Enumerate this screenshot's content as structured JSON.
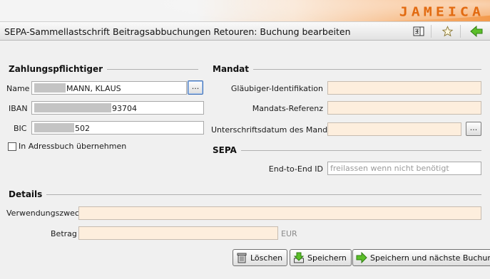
{
  "header": {
    "logo": "JAMEICA",
    "title": "SEPA-Sammellastschrift Beitragsabbuchungen Retouren: Buchung bearbeiten",
    "toolbar_icons": [
      "panel-toggle-icon",
      "star-icon",
      "back-arrow-icon"
    ]
  },
  "payer": {
    "heading": "Zahlungspflichtiger",
    "name_label": "Name",
    "name_value": "MANN, KLAUS",
    "iban_label": "IBAN",
    "iban_value": "93704",
    "bic_label": "BIC",
    "bic_value": "502",
    "browse_label": "...",
    "addressbook_label": "In Adressbuch übernehmen"
  },
  "mandate": {
    "heading": "Mandat",
    "creditor_label": "Gläubiger-Identifikation",
    "creditor_value": "",
    "reference_label": "Mandats-Referenz",
    "reference_value": "",
    "signature_date_label": "Unterschriftsdatum des Mandats",
    "signature_date_value": "",
    "date_picker_label": "..."
  },
  "sepa": {
    "heading": "SEPA",
    "e2e_label": "End-to-End ID",
    "e2e_placeholder": "freilassen wenn nicht benötigt"
  },
  "details": {
    "heading": "Details",
    "purpose_label": "Verwendungszweck",
    "purpose_value": "",
    "amount_label": "Betrag",
    "amount_value": "",
    "currency": "EUR"
  },
  "actions": {
    "delete_label": "Löschen",
    "save_label": "Speichern",
    "save_next_label": "Speichern und nächste Buchung"
  },
  "colors": {
    "required_field": "#fdeedd",
    "accent": "#e26a10",
    "nav_green": "#4fae2a"
  }
}
